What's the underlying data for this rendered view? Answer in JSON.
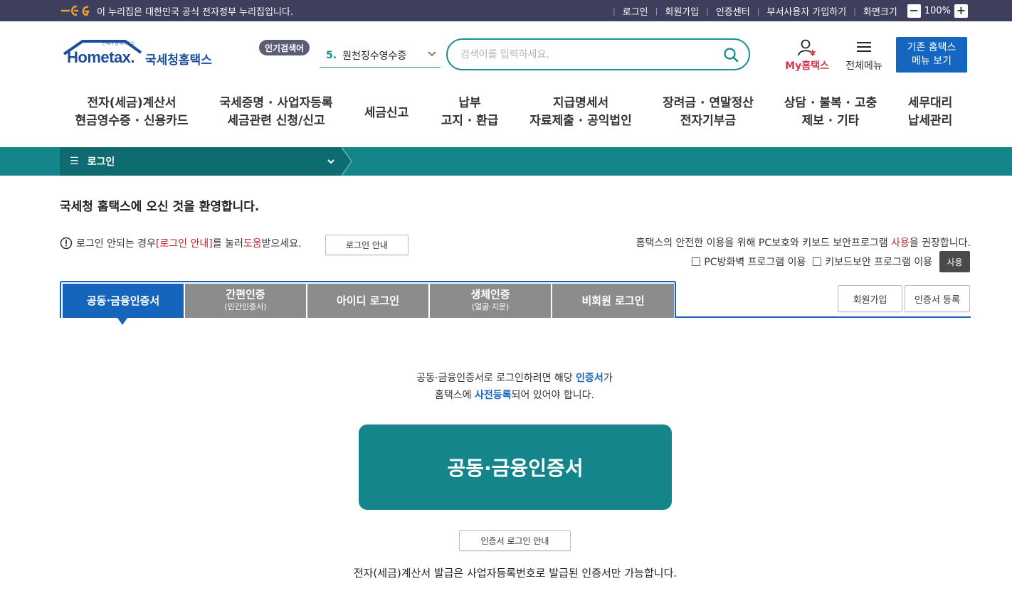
{
  "govbar": {
    "notice": "이 누리집은 대한민국 공식 전자정부 누리집입니다.",
    "links": [
      "로그인",
      "회원가입",
      "인증센터",
      "부서사용자 가입하기"
    ],
    "zoom_label": "화면크기",
    "zoom_minus": "−",
    "zoom_value": "100%",
    "zoom_plus": "+"
  },
  "logo": {
    "main": "Hometax.",
    "name": "국세청홈택스",
    "tagline": "언제나 납세서비스"
  },
  "popular": {
    "badge": "인기검색어",
    "rank": "5.",
    "keyword": "원천징수영수증"
  },
  "search": {
    "placeholder": "검색어를 입력하세요."
  },
  "header": {
    "my_label": "My홈택스",
    "allmenu_label": "전체메뉴",
    "oldmenu_line1": "기존 홈택스",
    "oldmenu_line2": "메뉴 보기"
  },
  "gnb": [
    {
      "l1": "전자(세금)계산서",
      "l2": "현금영수증 · 신용카드"
    },
    {
      "l1": "국세증명 · 사업자등록",
      "l2": "세금관련 신청/신고"
    },
    {
      "l1": "세금신고",
      "l2": ""
    },
    {
      "l1": "납부",
      "l2": "고지 · 환급"
    },
    {
      "l1": "지급명세서",
      "l2": "자료제출 · 공익법인"
    },
    {
      "l1": "장려금 · 연말정산",
      "l2": "전자기부금"
    },
    {
      "l1": "상담 · 불복 · 고충",
      "l2": "제보 · 기타"
    },
    {
      "l1": "세무대리",
      "l2": "납세관리"
    }
  ],
  "breadcrumb": {
    "label": "로그인"
  },
  "welcome": "국세청 홈택스에 오신 것을 환영합니다.",
  "guide": {
    "pre": "로그인 안되는 경우 ",
    "link1": "[로그인 안내]",
    "mid": "를 눌러 ",
    "link2": "도움",
    "post": "받으세요.",
    "button": "로그인 안내"
  },
  "security": {
    "pre": "홈택스의 안전한 이용을 위해 PC보호와 키보드 보안프로그램 ",
    "red": "사용",
    "post": "을 권장합니다.",
    "opt1": "PC방화벽 프로그램 이용",
    "opt2": "키보드보안 프로그램 이용",
    "use_button": "사용"
  },
  "tabs": [
    {
      "label": "공동·금융인증서",
      "sub": "",
      "active": true
    },
    {
      "label": "간편인증",
      "sub": "(민간인증서)",
      "active": false
    },
    {
      "label": "아이디 로그인",
      "sub": "",
      "active": false
    },
    {
      "label": "생체인증",
      "sub": "(얼굴·지문)",
      "active": false
    },
    {
      "label": "비회원 로그인",
      "sub": "",
      "active": false
    }
  ],
  "right_buttons": {
    "join": "회원가입",
    "cert_register": "인증서 등록"
  },
  "info": {
    "l1_pre": "공동·금융인증서로 로그인하려면 해당 ",
    "l1_blue": "인증서",
    "l1_post": "가",
    "l2_pre": "홈택스에 ",
    "l2_blue": "사전등록",
    "l2_post": "되어 있어야 합니다."
  },
  "main_button": "공동·금융인증서",
  "cert_guide_button": "인증서 로그인 안내",
  "note": "전자(세금)계산서 발급은 사업자등록번호로 발급된 인증서만 가능합니다.",
  "colors": {
    "teal": "#14858a",
    "teal_dark": "#0e6c71",
    "blue": "#1665bc",
    "govbar": "#3d3f5c",
    "tab_inactive": "#8c8c8c",
    "red": "#c0242d"
  }
}
